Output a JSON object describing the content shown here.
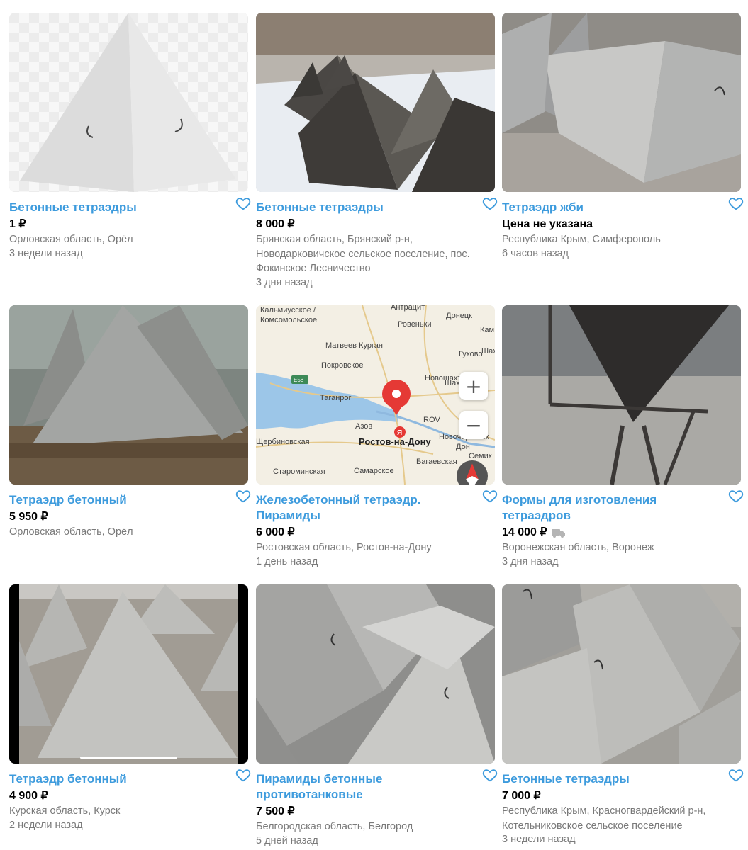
{
  "listings": [
    {
      "title": "Бетонные тетраэдры",
      "price": "1 ₽",
      "location": [
        "Орловская область, Орёл"
      ],
      "date": "3 недели назад",
      "image": "white-pyramid"
    },
    {
      "title": "Бетонные тетраэдры",
      "price": "8 000 ₽",
      "location": [
        "Брянская область, Брянский р-н,",
        "Новодарковичское сельское поселение, пос.",
        "Фокинское Лесничество"
      ],
      "date": "3 дня назад",
      "image": "pyramids-in-snow"
    },
    {
      "title": "Тетраэдр жби",
      "price": "Цена не указана",
      "location": [
        "Республика Крым, Симферополь"
      ],
      "date": "6 часов назад",
      "image": "tetrahedron-pile"
    },
    {
      "title": "Тетраэдр бетонный",
      "price": "5 950 ₽",
      "location": [
        "Орловская область, Орёл"
      ],
      "date": "",
      "image": "pyramids-on-pallet"
    },
    {
      "title": "Железобетонный тетраэдр. Пирамиды",
      "price": "6 000 ₽",
      "location": [
        "Ростовская область, Ростов-на-Дону"
      ],
      "date": "1 день назад",
      "image": "map"
    },
    {
      "title": "Формы для изготовления тетраэдров",
      "price": "14 000 ₽",
      "location": [
        "Воронежская область, Воронеж"
      ],
      "date": "3 дня назад",
      "image": "metal-mold",
      "delivery": true
    },
    {
      "title": "Тетраэдр бетонный",
      "price": "4 900 ₽",
      "location": [
        "Курская область, Курск"
      ],
      "date": "2 недели назад",
      "image": "pyramid-field"
    },
    {
      "title": "Пирамиды бетонные противотанковые",
      "price": "7 500 ₽",
      "location": [
        "Белгородская область, Белгород"
      ],
      "date": "5 дней назад",
      "image": "pyramids-closeup"
    },
    {
      "title": "Бетонные тетраэдры",
      "price": "7 000 ₽",
      "location": [
        "Республика Крым, Красногвардейский р-н,",
        "Котельниковское сельское поселение"
      ],
      "date": "3 недели назад",
      "image": "pyramids-outdoor"
    }
  ],
  "map": {
    "labels": [
      "Кальмиусское /",
      "Комсомольское",
      "Антрацит",
      "Ровеньки",
      "Донецк",
      "Кам",
      "Шах",
      "Гуково",
      "Матвеев Курган",
      "Покровское",
      "Новошахтинск",
      "Таганрог",
      "Шахты",
      "Азов",
      "ROV",
      "Семик",
      "Ростов-на-Дону",
      "Новочеркасск",
      "Щербиновская",
      "Багаевская",
      "Старominская",
      "Самарское",
      "E58",
      "Дон"
    ],
    "zoom_in": "+",
    "zoom_out": "−",
    "pin_letter": "Я"
  },
  "colors": {
    "title": "#3d9bdd",
    "muted": "#7a7a7a",
    "pin": "#e53935"
  }
}
